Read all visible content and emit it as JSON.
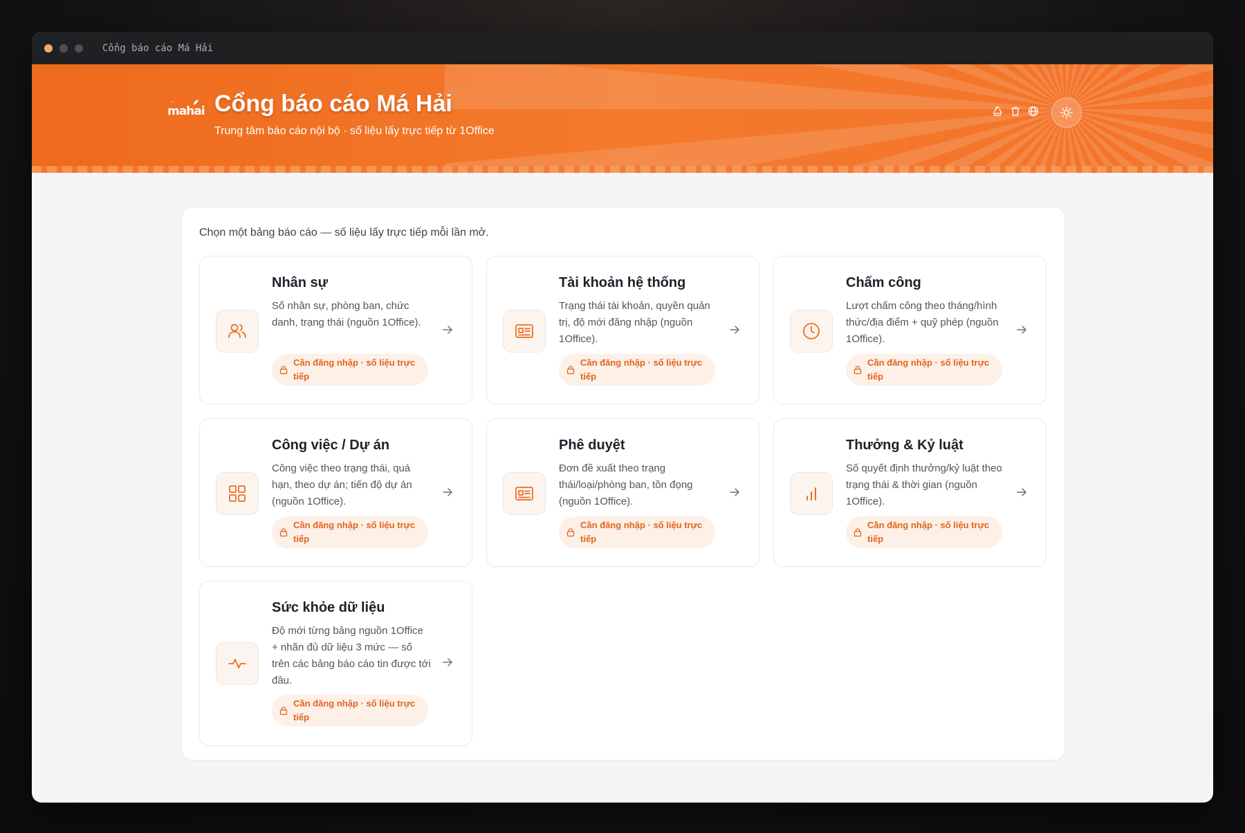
{
  "window": {
    "title": "Cổng báo cáo Má Hải"
  },
  "header": {
    "logo_text": "mahai",
    "title": "Cổng báo cáo Má Hải",
    "subtitle": "Trung tâm báo cáo nội bộ · số liệu lấy trực tiếp từ 1Office",
    "icons": [
      "recycle-icon",
      "trash-icon",
      "globe-icon"
    ],
    "theme_icon": "sun-icon"
  },
  "colors": {
    "accent": "#ef6c1f",
    "badge_bg": "#fdf0e7",
    "badge_text": "#e0651f"
  },
  "main": {
    "intro": "Chọn một bảng báo cáo — số liệu lấy trực tiếp mỗi lần mở.",
    "cards": [
      {
        "title": "Nhân sự",
        "description": "Số nhân sự, phòng ban, chức danh, trạng thái (nguồn 1Office).",
        "icon": "users-icon",
        "badge": "Cần đăng nhập · số liệu trực tiếp"
      },
      {
        "title": "Tài khoản hệ thống",
        "description": "Trạng thái tài khoản, quyền quản trị, độ mới đăng nhập (nguồn 1Office).",
        "icon": "id-card-icon",
        "badge": "Cần đăng nhập · số liệu trực tiếp"
      },
      {
        "title": "Chấm công",
        "description": "Lượt chấm công theo tháng/hình thức/địa điểm + quỹ phép (nguồn 1Office).",
        "icon": "clock-icon",
        "badge": "Cần đăng nhập · số liệu trực tiếp"
      },
      {
        "title": "Công việc / Dự án",
        "description": "Công việc theo trạng thái, quá hạn, theo dự án; tiến độ dự án (nguồn 1Office).",
        "icon": "grid-icon",
        "badge": "Cần đăng nhập · số liệu trực tiếp"
      },
      {
        "title": "Phê duyệt",
        "description": "Đơn đề xuất theo trạng thái/loại/phòng ban, tồn đọng (nguồn 1Office).",
        "icon": "id-card-icon",
        "badge": "Cần đăng nhập · số liệu trực tiếp"
      },
      {
        "title": "Thưởng & Kỷ luật",
        "description": "Số quyết định thưởng/kỷ luật theo trạng thái & thời gian (nguồn 1Office).",
        "icon": "bar-chart-icon",
        "badge": "Cần đăng nhập · số liệu trực tiếp"
      },
      {
        "title": "Sức khỏe dữ liệu",
        "description": "Độ mới từng bảng nguồn 1Office + nhãn đủ dữ liệu 3 mức — số trên các bảng báo cáo tin được tới đâu.",
        "icon": "pulse-icon",
        "badge": "Cần đăng nhập · số liệu trực tiếp"
      }
    ]
  }
}
